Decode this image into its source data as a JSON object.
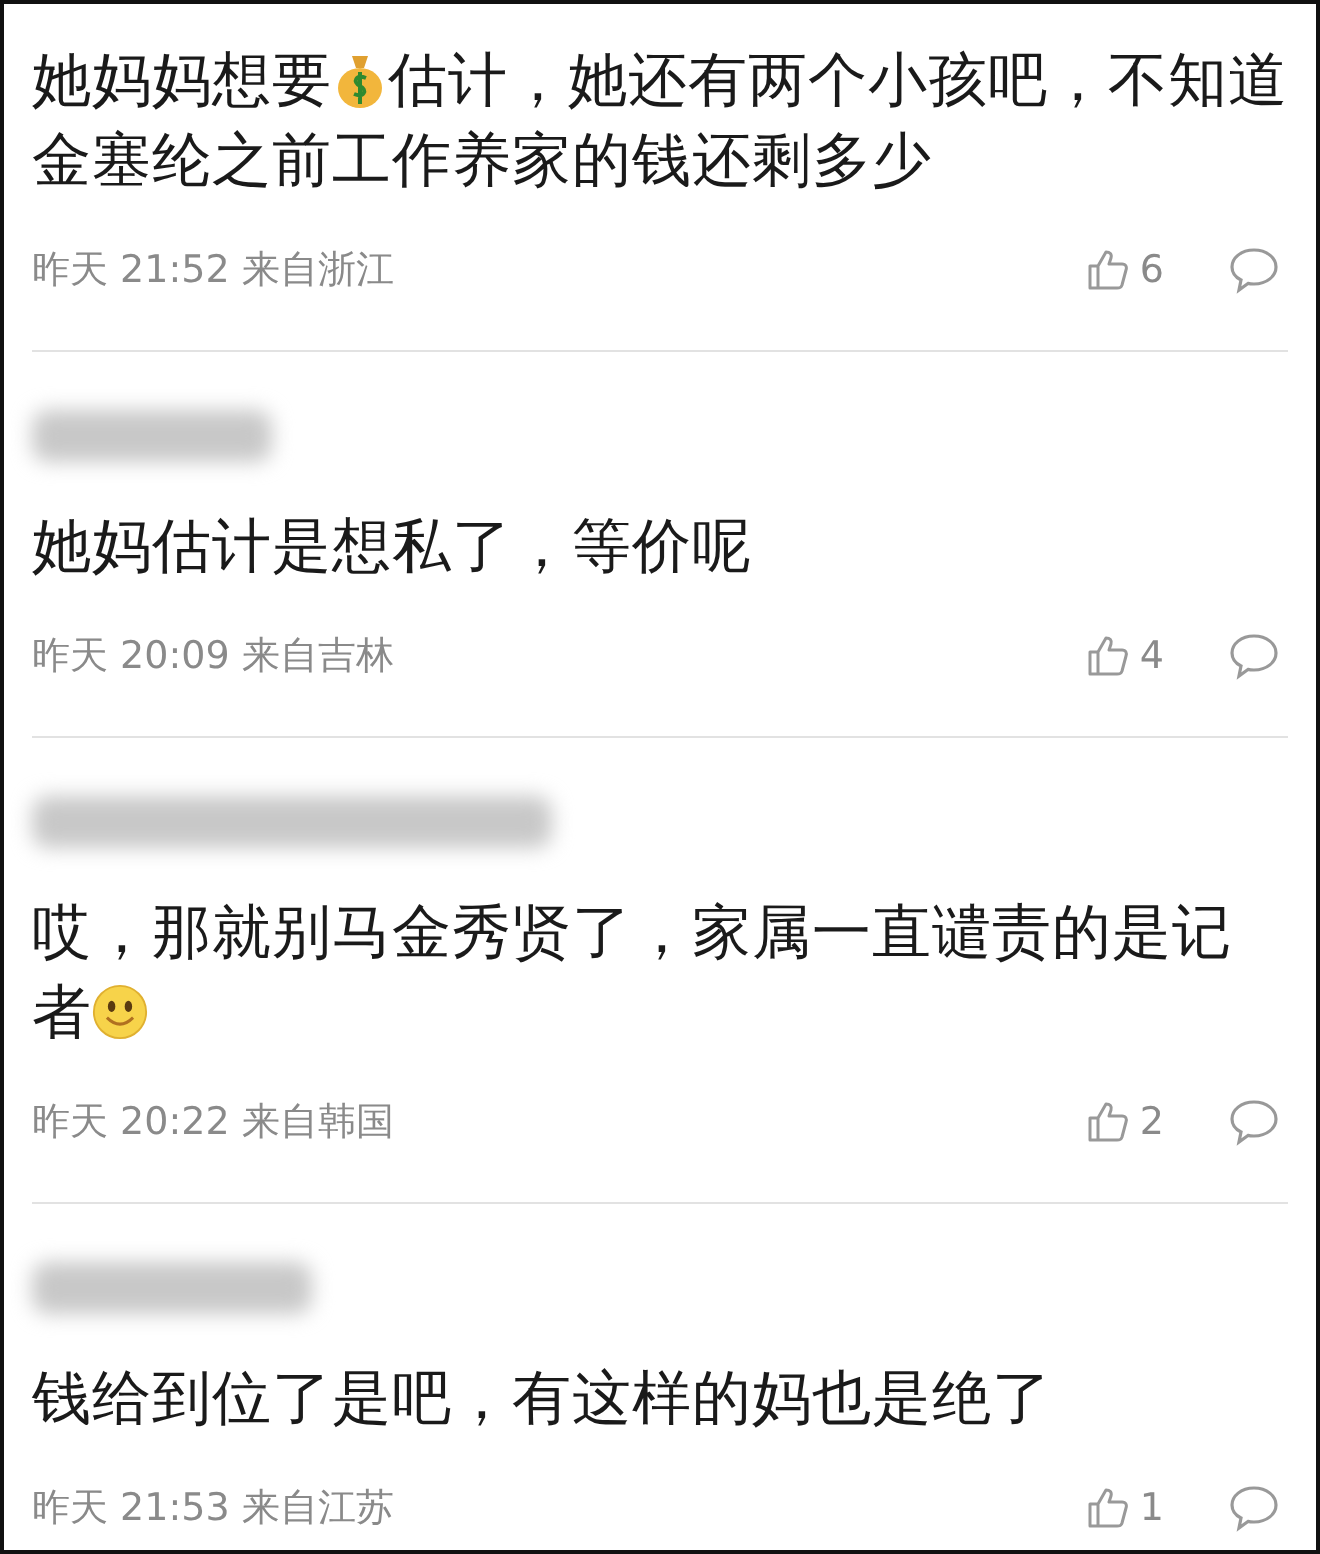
{
  "comments": [
    {
      "username_blurred": false,
      "content": [
        {
          "kind": "text",
          "text": "她妈妈想要"
        },
        {
          "kind": "money-bag"
        },
        {
          "kind": "text",
          "text": "估计，她还有两个小孩吧，不知道金塞纶之前工作养家的钱还剩多少"
        }
      ],
      "time": "昨天 21:52 来自浙江",
      "likes": "6"
    },
    {
      "username_blurred": true,
      "content": [
        {
          "kind": "text",
          "text": "她妈估计是想私了，等价呢"
        }
      ],
      "time": "昨天 20:09 来自吉林",
      "likes": "4"
    },
    {
      "username_blurred": true,
      "content": [
        {
          "kind": "text",
          "text": "哎，那就别马金秀贤了，家属一直谴责的是记者"
        },
        {
          "kind": "smiley"
        }
      ],
      "time": "昨天 20:22 来自韩国",
      "likes": "2"
    },
    {
      "username_blurred": true,
      "content": [
        {
          "kind": "text",
          "text": "钱给到位了是吧，有这样的妈也是绝了"
        }
      ],
      "time": "昨天 21:53 来自江苏",
      "likes": "1"
    }
  ]
}
